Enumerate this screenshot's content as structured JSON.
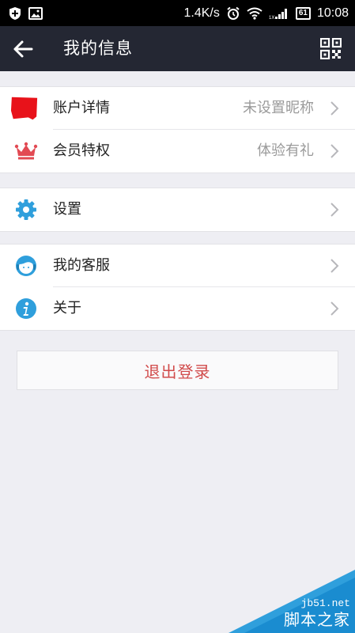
{
  "status_bar": {
    "net_speed": "1.4K/s",
    "battery": "61",
    "time": "10:08",
    "icons": [
      "shield-plus-icon",
      "image-icon",
      "alarm-icon",
      "wifi-icon",
      "signal-icon",
      "battery-icon"
    ]
  },
  "header": {
    "title": "我的信息",
    "back_icon": "back-arrow-icon",
    "qr_icon": "qr-code-icon"
  },
  "groups": [
    {
      "items": [
        {
          "label": "账户详情",
          "value": "未设置昵称",
          "icon": "avatar-icon"
        },
        {
          "label": "会员特权",
          "value": "体验有礼",
          "icon": "crown-icon"
        }
      ]
    },
    {
      "items": [
        {
          "label": "设置",
          "value": "",
          "icon": "gear-icon"
        }
      ]
    },
    {
      "items": [
        {
          "label": "我的客服",
          "value": "",
          "icon": "customer-service-icon"
        },
        {
          "label": "关于",
          "value": "",
          "icon": "info-icon"
        }
      ]
    }
  ],
  "logout_label": "退出登录",
  "watermark": {
    "small": "jb51.net",
    "big": "脚本之家"
  },
  "colors": {
    "header": "#242733",
    "accent_blue": "#2f9fdc",
    "logout_text": "#d14b4b",
    "crown": "#e24a53"
  }
}
